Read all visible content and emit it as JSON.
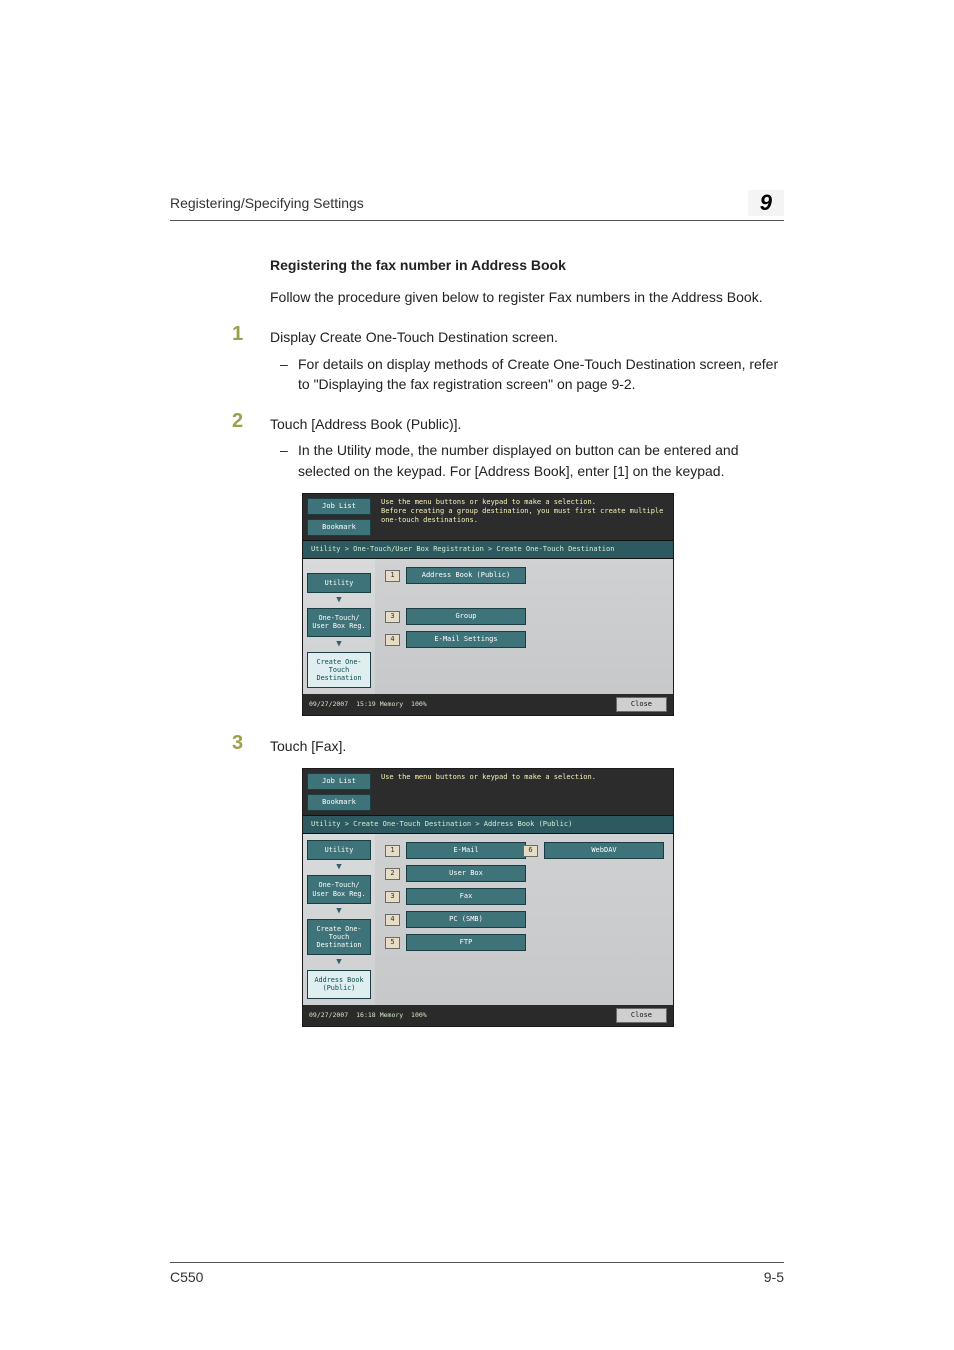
{
  "header": {
    "section_title": "Registering/Specifying Settings",
    "chapter_number": "9"
  },
  "h3": "Registering the fax number in Address Book",
  "intro": "Follow the procedure given below to register Fax numbers in the Address Book.",
  "steps": {
    "s1": {
      "num": "1",
      "text": "Display Create One-Touch Destination screen.",
      "sub": "For details on display methods of Create One-Touch Destination screen, refer to \"Displaying the fax registration screen\" on page 9-2."
    },
    "s2": {
      "num": "2",
      "text": "Touch [Address Book (Public)].",
      "sub": "In the Utility mode, the number displayed on button can be entered and selected on the keypad. For [Address Book], enter [1] on the keypad."
    },
    "s3": {
      "num": "3",
      "text": "Touch [Fax]."
    }
  },
  "shot1": {
    "job_list": "Job List",
    "bookmark": "Bookmark",
    "hint": "Use the menu buttons or keypad to make a selection.\nBefore creating a group destination, you must first create multiple\none-touch destinations.",
    "crumb": "Utility > One-Touch/User Box Registration > Create One-Touch Destination",
    "nav": {
      "utility": "Utility",
      "onetouch": "One-Touch/\nUser Box Reg.",
      "create": "Create One-Touch\nDestination"
    },
    "items": {
      "n1": "1",
      "b1": "Address Book (Public)",
      "n3": "3",
      "b3": "Group",
      "n4": "4",
      "b4": "E-Mail Settings"
    },
    "status": {
      "date": "09/27/2007",
      "time": "15:19",
      "mem_label": "Memory",
      "mem": "100%",
      "close": "Close"
    }
  },
  "shot2": {
    "job_list": "Job List",
    "bookmark": "Bookmark",
    "hint": "Use the menu buttons or keypad to make a selection.",
    "crumb": "Utility > Create One-Touch Destination > Address Book (Public)",
    "nav": {
      "utility": "Utility",
      "onetouch": "One-Touch/\nUser Box Reg.",
      "create": "Create One-Touch\nDestination",
      "abook": "Address Book\n(Public)"
    },
    "items": {
      "n1": "1",
      "b1": "E-Mail",
      "n2": "2",
      "b2": "User Box",
      "n3": "3",
      "b3": "Fax",
      "n4": "4",
      "b4": "PC (SMB)",
      "n5": "5",
      "b5": "FTP",
      "n6": "6",
      "b6": "WebDAV"
    },
    "status": {
      "date": "09/27/2007",
      "time": "16:18",
      "mem_label": "Memory",
      "mem": "100%",
      "close": "Close"
    }
  },
  "footer": {
    "model": "C550",
    "page": "9-5"
  }
}
